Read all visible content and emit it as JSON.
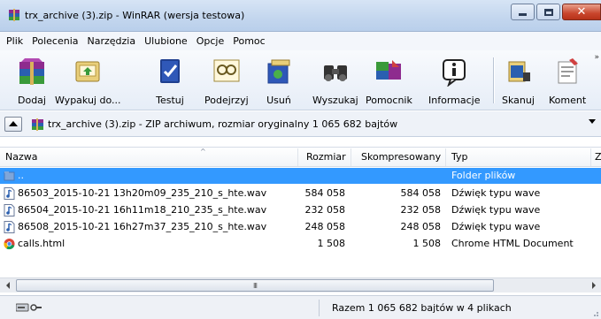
{
  "window": {
    "title": "trx_archive (3).zip - WinRAR (wersja testowa)"
  },
  "menu": [
    {
      "label": "Plik"
    },
    {
      "label": "Polecenia"
    },
    {
      "label": "Narzędzia"
    },
    {
      "label": "Ulubione"
    },
    {
      "label": "Opcje"
    },
    {
      "label": "Pomoc"
    }
  ],
  "toolbar": {
    "buttons": [
      {
        "label": "Dodaj",
        "icon": "add-archive-icon"
      },
      {
        "label": "Wypakuj do...",
        "icon": "extract-icon"
      },
      {
        "label": "Testuj",
        "icon": "test-icon"
      },
      {
        "label": "Podejrzyj",
        "icon": "view-icon"
      },
      {
        "label": "Usuń",
        "icon": "delete-icon"
      },
      {
        "label": "Wyszukaj",
        "icon": "find-icon"
      },
      {
        "label": "Pomocnik",
        "icon": "wizard-icon"
      },
      {
        "label": "Informacje",
        "icon": "info-icon"
      },
      {
        "label": "Skanuj",
        "icon": "scan-icon"
      },
      {
        "label": "Koment",
        "icon": "comment-icon"
      }
    ]
  },
  "address": {
    "text": "trx_archive (3).zip - ZIP archiwum, rozmiar oryginalny 1 065 682 bajtów"
  },
  "columns": {
    "name": "Nazwa",
    "size": "Rozmiar",
    "packed": "Skompresowany",
    "type": "Typ",
    "extra": "Z"
  },
  "files": [
    {
      "name": "..",
      "size": "",
      "packed": "",
      "type": "Folder plików",
      "icon": "folder-icon",
      "selected": true
    },
    {
      "name": "86503_2015-10-21 13h20m09_235_210_s_hte.wav",
      "size": "584 058",
      "packed": "584 058",
      "type": "Dźwięk typu wave",
      "icon": "wave-file-icon",
      "selected": false
    },
    {
      "name": "86504_2015-10-21 16h11m18_210_235_s_hte.wav",
      "size": "232 058",
      "packed": "232 058",
      "type": "Dźwięk typu wave",
      "icon": "wave-file-icon",
      "selected": false
    },
    {
      "name": "86508_2015-10-21 16h27m37_235_210_s_hte.wav",
      "size": "248 058",
      "packed": "248 058",
      "type": "Dźwięk typu wave",
      "icon": "wave-file-icon",
      "selected": false
    },
    {
      "name": "calls.html",
      "size": "1 508",
      "packed": "1 508",
      "type": "Chrome HTML Document",
      "icon": "chrome-html-icon",
      "selected": false
    }
  ],
  "scrollbar": {
    "grip": "III"
  },
  "status": {
    "text": "Razem 1 065 682 bajtów w 4 plikach"
  },
  "colors": {
    "selection": "#3399ff",
    "titlebar": "#c3d6ee",
    "close_button": "#c9462d"
  }
}
